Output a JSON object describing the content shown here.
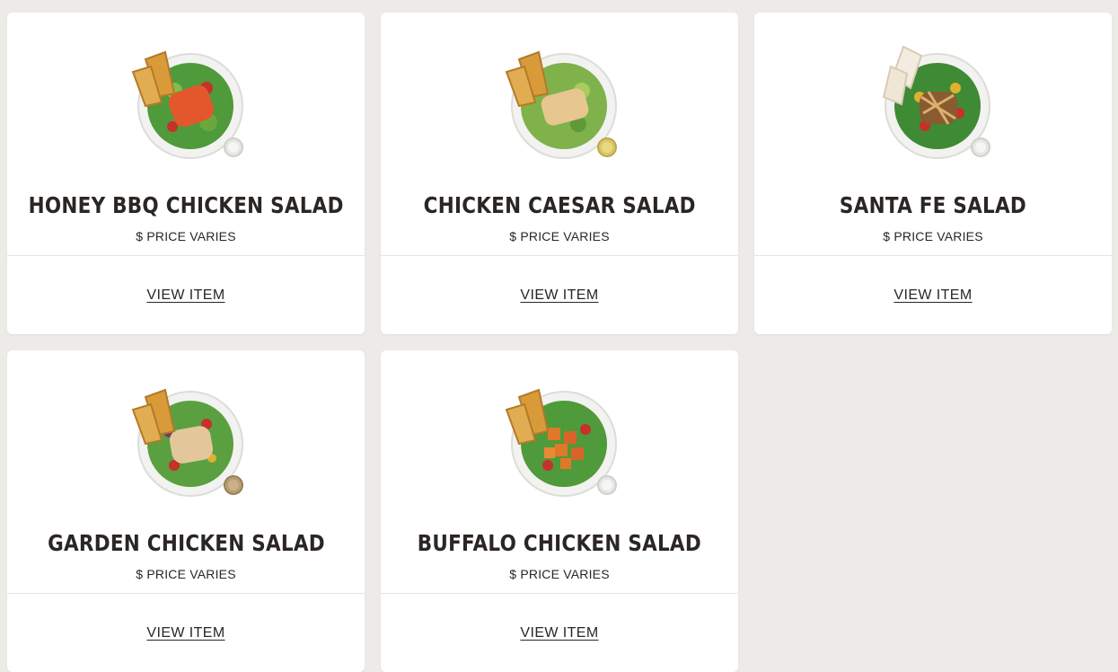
{
  "menu": {
    "items": [
      {
        "name": "HONEY BBQ CHICKEN SALAD",
        "price": "$ PRICE VARIES",
        "cta": "VIEW ITEM",
        "image_icon": "honey-bbq-salad-image",
        "topping_color": "#e2582c"
      },
      {
        "name": "CHICKEN CAESAR SALAD",
        "price": "$ PRICE VARIES",
        "cta": "VIEW ITEM",
        "image_icon": "caesar-salad-image",
        "topping_color": "#e8c690"
      },
      {
        "name": "SANTA FE SALAD",
        "price": "$ PRICE VARIES",
        "cta": "VIEW ITEM",
        "image_icon": "santa-fe-salad-image",
        "topping_color": "#8a5a30"
      },
      {
        "name": "GARDEN CHICKEN SALAD",
        "price": "$ PRICE VARIES",
        "cta": "VIEW ITEM",
        "image_icon": "garden-salad-image",
        "topping_color": "#e3c79a"
      },
      {
        "name": "BUFFALO CHICKEN SALAD",
        "price": "$ PRICE VARIES",
        "cta": "VIEW ITEM",
        "image_icon": "buffalo-salad-image",
        "topping_color": "#e0782a"
      }
    ]
  },
  "colors": {
    "page_background": "#ecebe8",
    "card_background": "#ffffff",
    "text": "#2b2624",
    "lettuce": "#4f9a3a",
    "bread": "#d99a3a"
  }
}
